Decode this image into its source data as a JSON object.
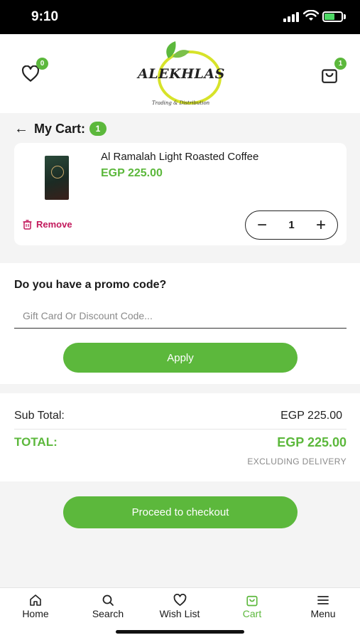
{
  "status_bar": {
    "time": "9:10"
  },
  "header": {
    "wishlist_badge": "0",
    "cart_badge": "1",
    "logo_text": "ALEKHLAS",
    "logo_subtitle": "Trading & Distribution"
  },
  "cart": {
    "title": "My Cart:",
    "count": "1",
    "items": [
      {
        "name": "Al Ramalah Light Roasted Coffee",
        "price": "EGP 225.00",
        "quantity": "1",
        "remove_label": "Remove"
      }
    ]
  },
  "promo": {
    "title": "Do you have a promo code?",
    "placeholder": "Gift Card Or Discount Code...",
    "apply_label": "Apply"
  },
  "totals": {
    "sub_total_label": "Sub Total:",
    "sub_total_value": "EGP 225.00",
    "total_label": "TOTAL:",
    "total_value": "EGP 225.00",
    "note": "EXCLUDING DELIVERY"
  },
  "checkout_label": "Proceed to checkout",
  "nav": {
    "items": [
      {
        "label": "Home",
        "icon": "home-icon"
      },
      {
        "label": "Search",
        "icon": "search-icon"
      },
      {
        "label": "Wish List",
        "icon": "heart-icon"
      },
      {
        "label": "Cart",
        "icon": "bag-icon"
      },
      {
        "label": "Menu",
        "icon": "menu-icon"
      }
    ],
    "active": "Cart"
  },
  "colors": {
    "accent": "#5cb83c",
    "remove": "#c2185b"
  }
}
